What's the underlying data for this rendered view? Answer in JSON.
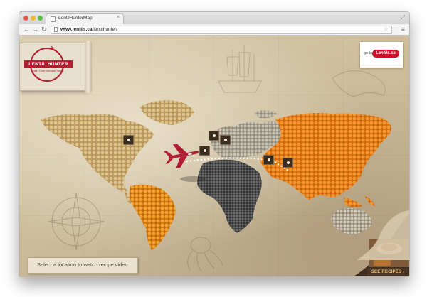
{
  "browser": {
    "tab_title": "LentilHunterMap",
    "url_host": "www.lentils.ca",
    "url_path": "/lentilhunter/",
    "traffic_lights": [
      "#e9574f",
      "#f3b732",
      "#53c142"
    ]
  },
  "page": {
    "logo": {
      "title": "LENTIL HUNTER",
      "subtitle": "with Chef Michael Smith"
    },
    "goto": {
      "label": "go to",
      "brand": "Lentils.ca"
    },
    "status_text": "Select a location to watch recipe video",
    "see_recipes_label": "SEE RECIPES ›",
    "markers": [
      "north-america",
      "europe-west",
      "europe-east",
      "west-africa",
      "middle-east",
      "india"
    ],
    "colors": {
      "brand_red": "#c7122a",
      "americas_north": "#c8a86a",
      "americas_south": "#e08a18",
      "europe": "#a9a290",
      "africa": "#4b4b4b",
      "asia": "#e27a13",
      "australia": "#b0a695"
    }
  }
}
